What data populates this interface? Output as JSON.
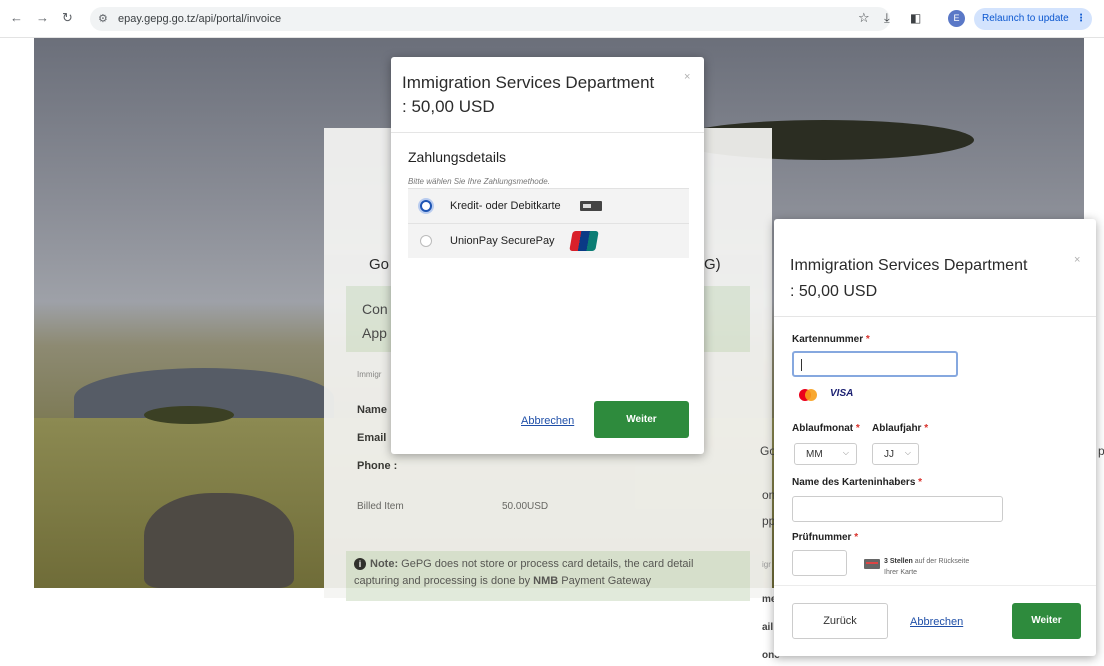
{
  "browser": {
    "url": "epay.gepg.go.tz/api/portal/invoice",
    "relaunch_label": "Relaunch to update",
    "profile_initial": "E"
  },
  "page": {
    "title_left": "Go",
    "title_right": "PG)",
    "green_line1": "Con",
    "green_line2": "App",
    "small_label": "Immigr",
    "name_label": "Name",
    "email_label": "Email",
    "phone_label": "Phone :",
    "billed_label": "Billed Item",
    "billed_value": "50.00USD",
    "note_bold": "Note:",
    "note_text1": " GePG does not store or process card details, the card detail",
    "note_text2_pre": "capturing and processing is done by ",
    "note_text2_bold": "NMB",
    "note_text2_post": " Payment Gateway"
  },
  "modal1": {
    "title_line1": "Immigration Services Department",
    "title_line2": ": 50,00 USD",
    "close": "×",
    "heading": "Zahlungsdetails",
    "subtitle": "Bitte wählen Sie Ihre Zahlungsmethode.",
    "options": [
      {
        "label": "Kredit- oder Debitkarte",
        "selected": true
      },
      {
        "label": "UnionPay SecurePay",
        "selected": false
      }
    ],
    "cancel_label": "Abbrechen",
    "next_label": "Weiter"
  },
  "modal2": {
    "title_line1": "Immigration Services Department",
    "title_line2": ": 50,00 USD",
    "close": "×",
    "card_number_label": "Kartennummer",
    "card_number_value": "",
    "card_brand_visa": "VISA",
    "exp_month_label": "Ablaufmonat",
    "exp_year_label": "Ablaufjahr",
    "exp_month_value": "MM",
    "exp_year_value": "JJ",
    "holder_label": "Name des Karteninhabers",
    "holder_value": "",
    "cvv_label": "Prüfnummer",
    "cvv_value": "",
    "cvv_hint_bold": "3 Stellen",
    "cvv_hint_text1": " auf der Rückseite",
    "cvv_hint_text2": "Ihrer Karte",
    "back_label": "Zurück",
    "cancel_label": "Abbrechen",
    "next_label": "Weiter",
    "required_mark": "*"
  },
  "peek": {
    "go": "Go",
    "on": "on",
    "pp": "pp",
    "igr": "igr",
    "me": "me",
    "ail": "ail",
    "one": "one",
    "p_right": "p"
  },
  "colors": {
    "accent_green": "#2e8b3d",
    "link_blue": "#1f4fa8",
    "focus_blue": "#86a8df"
  }
}
